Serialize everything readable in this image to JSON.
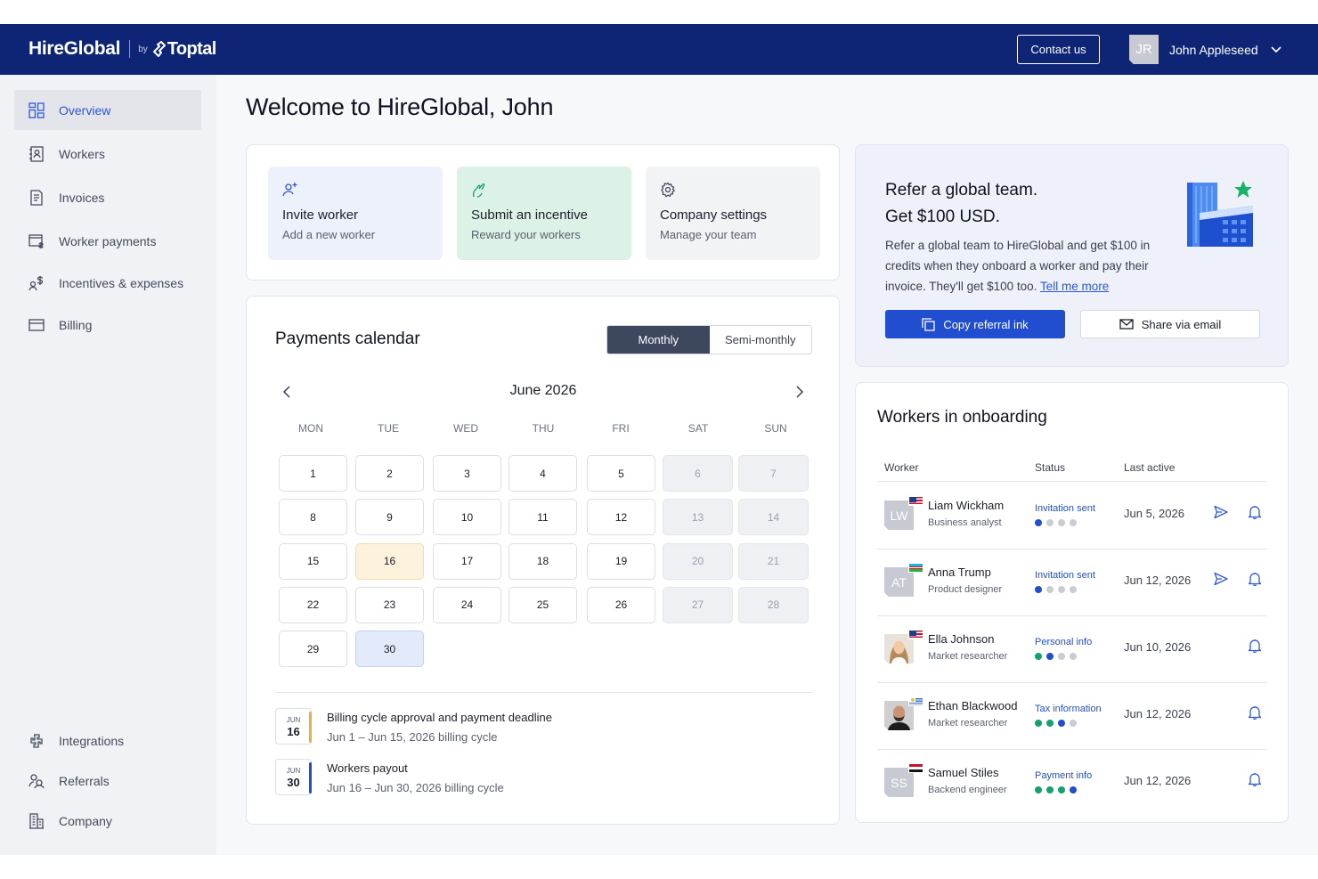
{
  "header": {
    "brand": "HireGlobal",
    "by": "by",
    "partner": "Toptal",
    "contact_label": "Contact us",
    "user_initials": "JR",
    "user_name": "John Appleseed"
  },
  "sidebar": {
    "items": [
      {
        "label": "Overview",
        "icon": "overview-grid-icon",
        "active": true
      },
      {
        "label": "Workers",
        "icon": "workers-icon"
      },
      {
        "label": "Invoices",
        "icon": "invoice-icon"
      },
      {
        "label": "Worker payments",
        "icon": "payments-icon"
      },
      {
        "label": "Incentives & expenses",
        "icon": "incentives-icon"
      },
      {
        "label": "Billing",
        "icon": "credit-card-icon"
      }
    ],
    "bottom_items": [
      {
        "label": "Integrations",
        "icon": "integrations-icon"
      },
      {
        "label": "Referrals",
        "icon": "referrals-icon"
      },
      {
        "label": "Company",
        "icon": "building-icon"
      }
    ]
  },
  "main": {
    "welcome": "Welcome to HireGlobal, John",
    "quick_actions": [
      {
        "title": "Invite worker",
        "subtitle": "Add a new worker",
        "icon": "user-plus-icon",
        "bg": "#edf1fc"
      },
      {
        "title": "Submit an incentive",
        "subtitle": "Reward your workers",
        "icon": "incentive-icon",
        "bg": "#dcf2e6"
      },
      {
        "title": "Company settings",
        "subtitle": "Manage your team",
        "icon": "gear-icon",
        "bg": "#f2f3f5"
      }
    ]
  },
  "calendar": {
    "title": "Payments calendar",
    "toggle": {
      "monthly": "Monthly",
      "semi_monthly": "Semi-monthly",
      "selected": "Monthly"
    },
    "month_label": "June 2026",
    "weekdays": [
      "MON",
      "TUE",
      "WED",
      "THU",
      "FRI",
      "SAT",
      "SUN"
    ],
    "weeks": [
      [
        "1",
        "2",
        "3",
        "4",
        "5",
        "6",
        "7"
      ],
      [
        "8",
        "9",
        "10",
        "11",
        "12",
        "13",
        "14"
      ],
      [
        "15",
        "16",
        "17",
        "18",
        "19",
        "20",
        "21"
      ],
      [
        "22",
        "23",
        "24",
        "25",
        "26",
        "27",
        "28"
      ],
      [
        "29",
        "30"
      ]
    ],
    "highlight_today": "16",
    "highlight_selected": "30",
    "events": [
      {
        "month": "JUN",
        "day": "16",
        "title": "Billing cycle approval and payment deadline",
        "subtitle": "Jun 1 – Jun 15, 2026 billing cycle",
        "accent": "#e8b23a"
      },
      {
        "month": "JUN",
        "day": "30",
        "title": "Workers payout",
        "subtitle": "Jun 16 – Jun 30, 2026 billing cycle",
        "accent": "#204ecf"
      }
    ]
  },
  "referral": {
    "headline1": "Refer a global team.",
    "headline2": "Get $100 USD.",
    "body": "Refer a global team to HireGlobal and get $100 in credits when they onboard a worker and pay their invoice. They'll get $100 too.",
    "link": "Tell me more",
    "copy_label": "Copy referral ink",
    "share_label": "Share via email"
  },
  "onboarding": {
    "title": "Workers in onboarding",
    "columns": [
      "Worker",
      "Status",
      "Last active"
    ],
    "rows": [
      {
        "initials": "LW",
        "name": "Liam Wickham",
        "role": "Business analyst",
        "status": "Invitation sent",
        "progress": 1,
        "progress_color": "#204ecf",
        "last_active": "Jun 5, 2026",
        "flag": "us",
        "send": true
      },
      {
        "initials": "AT",
        "name": "Anna Trump",
        "role": "Product designer",
        "status": "Invitation sent",
        "progress": 1,
        "progress_color": "#204ecf",
        "last_active": "Jun 12, 2026",
        "flag": "uz",
        "send": true
      },
      {
        "initials": "",
        "name": "Ella Johnson",
        "role": "Market researcher",
        "status": "Personal info",
        "progress": 2,
        "progress_color": "mixed",
        "last_active": "Jun 10, 2026",
        "flag": "us",
        "send": false,
        "photo": "woman"
      },
      {
        "initials": "",
        "name": "Ethan Blackwood",
        "role": "Market researcher",
        "status": "Tax information",
        "progress": 3,
        "progress_color": "mixed",
        "last_active": "Jun 12, 2026",
        "flag": "uy",
        "send": false,
        "photo": "man"
      },
      {
        "initials": "SS",
        "name": "Samuel Stiles",
        "role": "Backend engineer",
        "status": "Payment info",
        "progress": 4,
        "progress_color": "mixed",
        "last_active": "Jun 12, 2026",
        "flag": "eg",
        "send": false
      }
    ]
  }
}
